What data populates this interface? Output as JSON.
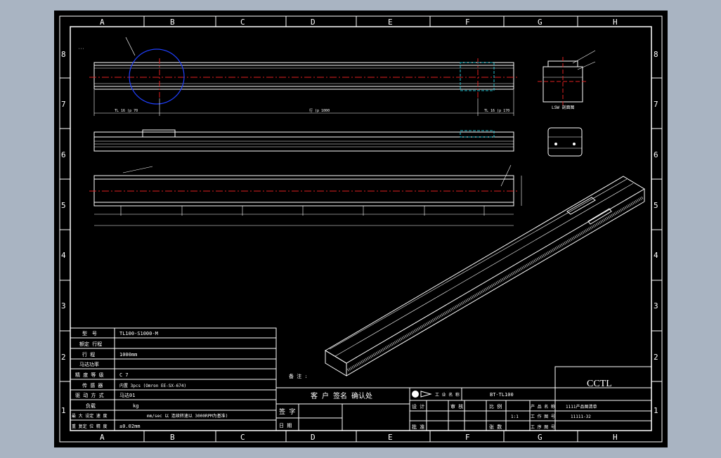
{
  "colors": {
    "background": "#a9b4c2",
    "sheet": "#000000",
    "line": "#ffffff",
    "centerline": "#e02020",
    "circle": "#2040ff",
    "hidden": "#20c0d0"
  },
  "zones": {
    "columns": [
      "A",
      "B",
      "C",
      "D",
      "E",
      "F",
      "G",
      "H"
    ],
    "rows": [
      "8",
      "7",
      "6",
      "5",
      "4",
      "3",
      "2",
      "1"
    ]
  },
  "top_view": {
    "left_dim": "TL 16 (p 70",
    "mid_dim": "行 (p 1000",
    "right_dim": "TL 16 (p 170"
  },
  "end_view_label": "LSW 剖面图",
  "params": [
    {
      "label": "型　号",
      "value": "TL100-S1000-M"
    },
    {
      "label": "额定 行程",
      "value": ""
    },
    {
      "label": "行 程",
      "value": "1000mm"
    },
    {
      "label": "马达功率",
      "value": ""
    },
    {
      "label": "精 度 等 级",
      "value": "C 7"
    },
    {
      "label": "传 感 器",
      "value": "内置 3pcs (Omron EE-SX-674)"
    },
    {
      "label": "驱 动 方 式",
      "value": "马达01"
    },
    {
      "label": "负载",
      "value": "kg"
    },
    {
      "label": "最 大 设定 速 度",
      "value": "mm/sec 以 连续转速以 3000RPM为基准)"
    },
    {
      "label": "重 复定 位 精 度",
      "value": "±0.02mm"
    }
  ],
  "note_label": "备 注 :",
  "approval": {
    "title": "客 户 签名 确认处",
    "sign": "签 字",
    "date": "日 期"
  },
  "title_block": {
    "company": "CCTL",
    "logo_label": "工 业 名 称",
    "drawing_title": "BT-TL100",
    "designer": "设 计",
    "checker": "审 核",
    "approver": "批 准",
    "scale_label": "比 例",
    "scale_value": "1:1",
    "sheet_label": "张 数",
    "product_name_label": "产 品 名 称",
    "product_name_value": "1111产品图清单",
    "drawing_no_label": "工 作 图 号",
    "drawing_no_value": "11111-32",
    "part_label": "工 序 图 号"
  }
}
